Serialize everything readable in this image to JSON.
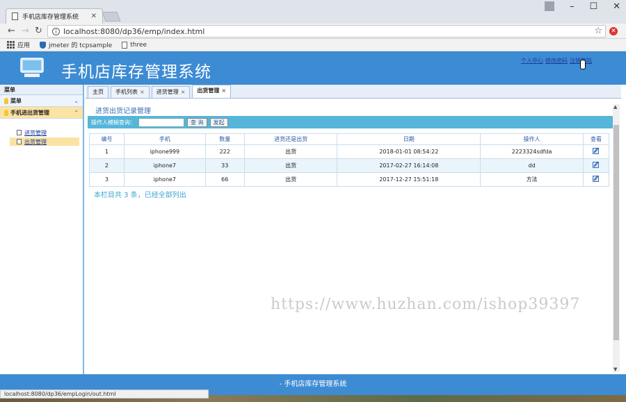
{
  "browser": {
    "tab_title": "手机店库存管理系统",
    "url": "localhost:8080/dp36/emp/index.html",
    "bookmarks": [
      {
        "label": "应用",
        "icon": "apps-icon"
      },
      {
        "label": "jmeter 的 tcpsample",
        "icon": "shield-icon"
      },
      {
        "label": "three",
        "icon": "page-icon"
      }
    ],
    "status_url": "localhost:8080/dp36/empLogin/out.html"
  },
  "header": {
    "title": "手机店库存管理系统",
    "links": [
      "个人中心",
      "修改密码",
      "注销登陆"
    ]
  },
  "sidebar": {
    "title": "菜单",
    "sections": [
      {
        "label": "菜单",
        "expanded": false
      },
      {
        "label": "手机进出货管理",
        "expanded": true
      }
    ],
    "items": [
      {
        "label": "进货管理",
        "selected": false
      },
      {
        "label": "出货管理",
        "selected": true
      }
    ]
  },
  "tabs": [
    {
      "label": "主页",
      "closable": false
    },
    {
      "label": "手机列表",
      "closable": true
    },
    {
      "label": "进货管理",
      "closable": true
    },
    {
      "label": "出货管理",
      "closable": true,
      "active": true
    }
  ],
  "page": {
    "title": "进货出货记录管理",
    "search_label": "操作人模糊查询：",
    "search_value": "",
    "query_button": "查 询",
    "reset_button": "发起"
  },
  "table": {
    "columns": [
      "编号",
      "手机",
      "数量",
      "进货还是出货",
      "日期",
      "操作人",
      "查看"
    ],
    "rows": [
      [
        "1",
        "iphone999",
        "222",
        "出货",
        "2018-01-01 08:54:22",
        "2223324sdfda"
      ],
      [
        "2",
        "iphone7",
        "33",
        "出货",
        "2017-02-27 16:14:08",
        "dd"
      ],
      [
        "3",
        "iphone7",
        "66",
        "出货",
        "2017-12-27 15:51:18",
        "方法"
      ]
    ]
  },
  "summary": "本栏目共 3 条，已经全部列出",
  "watermark": "https://www.huzhan.com/ishop39397",
  "footer": "- 手机店库存管理系统"
}
